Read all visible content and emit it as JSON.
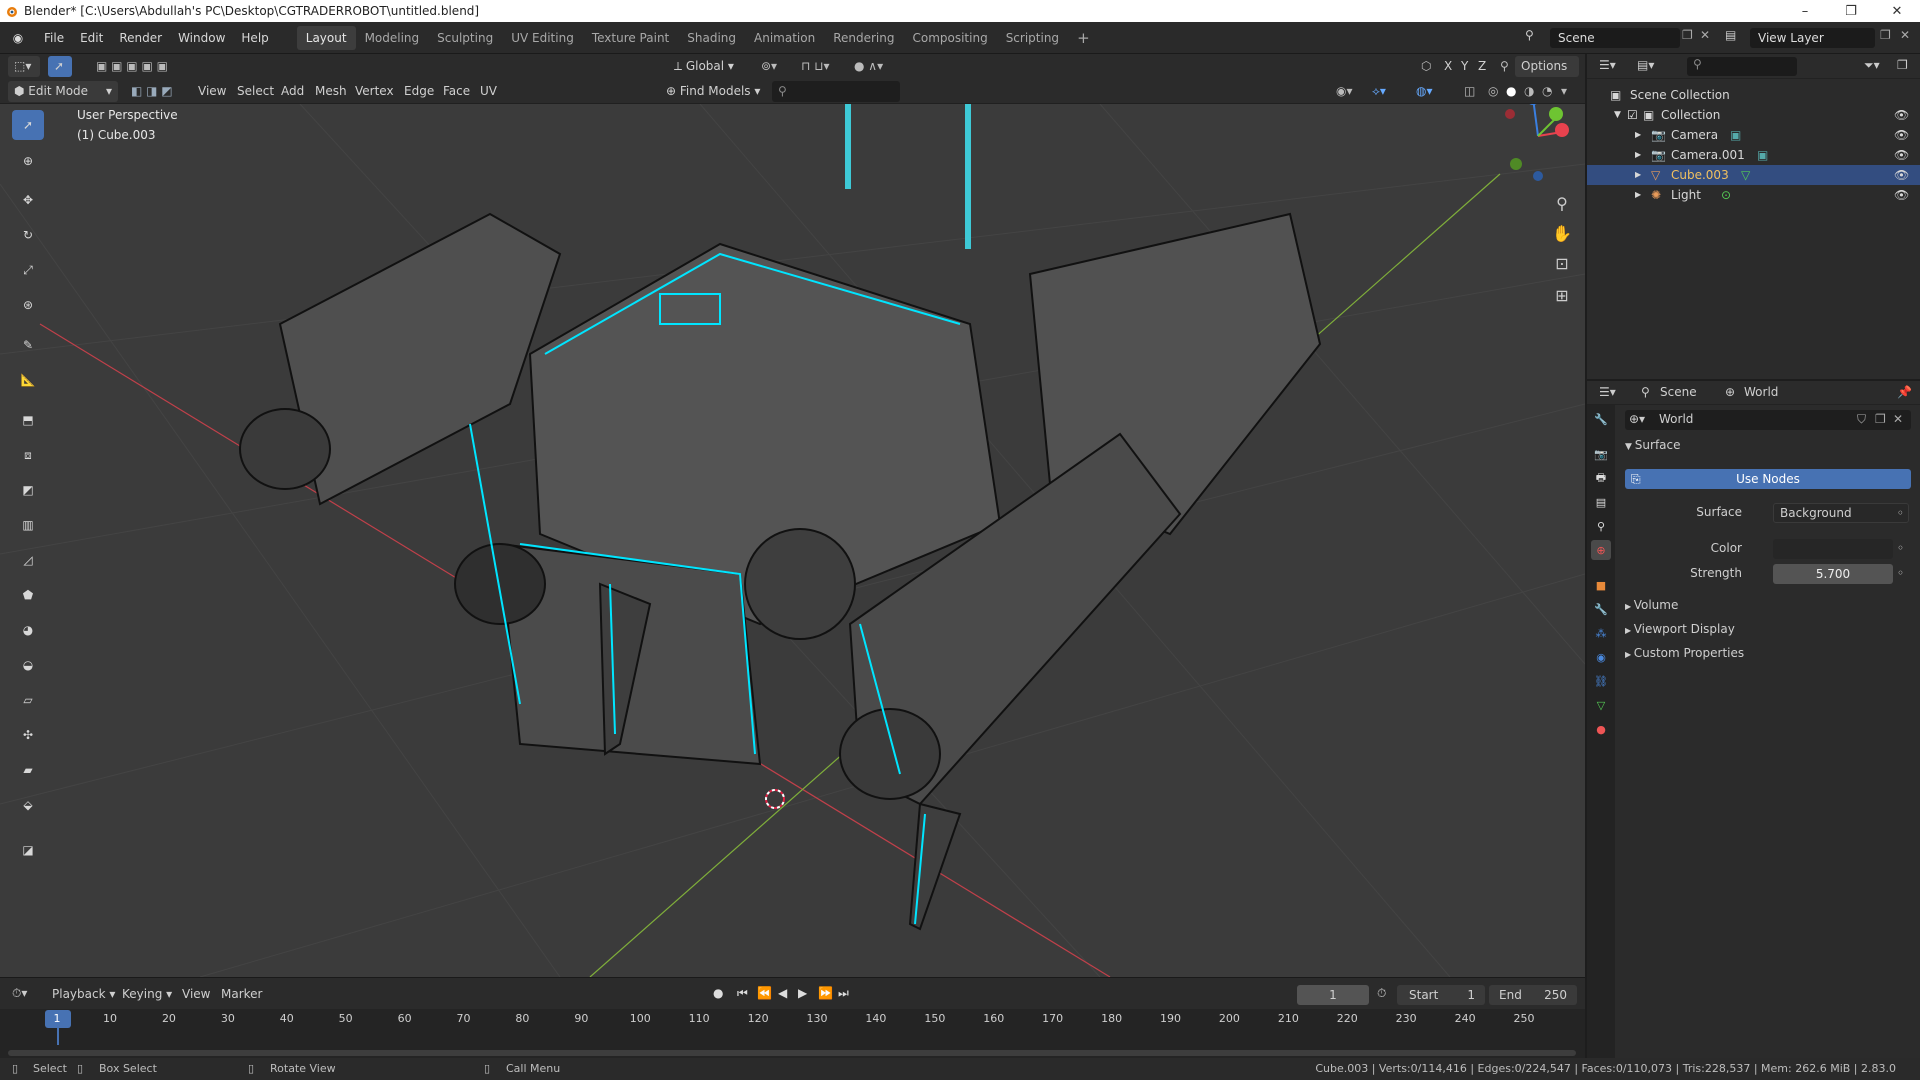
{
  "window": {
    "title": "Blender* [C:\\Users\\Abdullah's PC\\Desktop\\CGTRADERROBOT\\untitled.blend]",
    "controls": [
      "–",
      "❐",
      "✕"
    ]
  },
  "menu": [
    "File",
    "Edit",
    "Render",
    "Window",
    "Help"
  ],
  "workspaces": [
    "Layout",
    "Modeling",
    "Sculpting",
    "UV Editing",
    "Texture Paint",
    "Shading",
    "Animation",
    "Rendering",
    "Compositing",
    "Scripting"
  ],
  "active_workspace": "Layout",
  "add_workspace": "+",
  "scene": {
    "label": "Scene"
  },
  "view_layer": {
    "label": "View Layer"
  },
  "viewport_header": {
    "mode": "Edit Mode",
    "menus": [
      "View",
      "Select",
      "Add",
      "Mesh",
      "Vertex",
      "Edge",
      "Face",
      "UV"
    ],
    "orientation": "Global",
    "options": "Options",
    "find_models": "Find Models",
    "axes": [
      "X",
      "Y",
      "Z"
    ]
  },
  "viewport": {
    "perspective": "User Perspective",
    "object": "(1) Cube.003",
    "gizmo": {
      "x_color": "#e8424e",
      "y_color": "#6ec432",
      "z_color": "#3a7fe0"
    }
  },
  "outliner": {
    "root": "Scene Collection",
    "collection": "Collection",
    "items": [
      {
        "name": "Camera",
        "selected": false
      },
      {
        "name": "Camera.001",
        "selected": false
      },
      {
        "name": "Cube.003",
        "selected": true
      },
      {
        "name": "Light",
        "selected": false
      }
    ]
  },
  "properties": {
    "breadcrumb_scene": "Scene",
    "breadcrumb_world": "World",
    "world_name": "World",
    "surface_panel": "Surface",
    "use_nodes": "Use Nodes",
    "surface_label": "Surface",
    "surface_value": "Background",
    "color_label": "Color",
    "strength_label": "Strength",
    "strength_value": "5.700",
    "collapsed_panels": [
      "Volume",
      "Viewport Display",
      "Custom Properties"
    ]
  },
  "timeline": {
    "menus": [
      "Playback",
      "Keying",
      "View",
      "Marker"
    ],
    "current_frame": "1",
    "start_label": "Start",
    "start_value": "1",
    "end_label": "End",
    "end_value": "250",
    "ticks": [
      "1",
      "10",
      "20",
      "30",
      "40",
      "50",
      "60",
      "70",
      "80",
      "90",
      "100",
      "110",
      "120",
      "130",
      "140",
      "150",
      "160",
      "170",
      "180",
      "190",
      "200",
      "210",
      "220",
      "230",
      "240",
      "250"
    ]
  },
  "status_bar": {
    "select": "Select",
    "box_select": "Box Select",
    "rotate_view": "Rotate View",
    "call_menu": "Call Menu",
    "stats": "Cube.003 | Verts:0/114,416 | Edges:0/224,547 | Faces:0/110,073 | Tris:228,537 | Mem: 262.6 MiB | 2.83.0"
  },
  "colors": {
    "accent": "#4772b3",
    "selection": "#00e5ff",
    "viewport_bg": "#3b3b3b"
  }
}
